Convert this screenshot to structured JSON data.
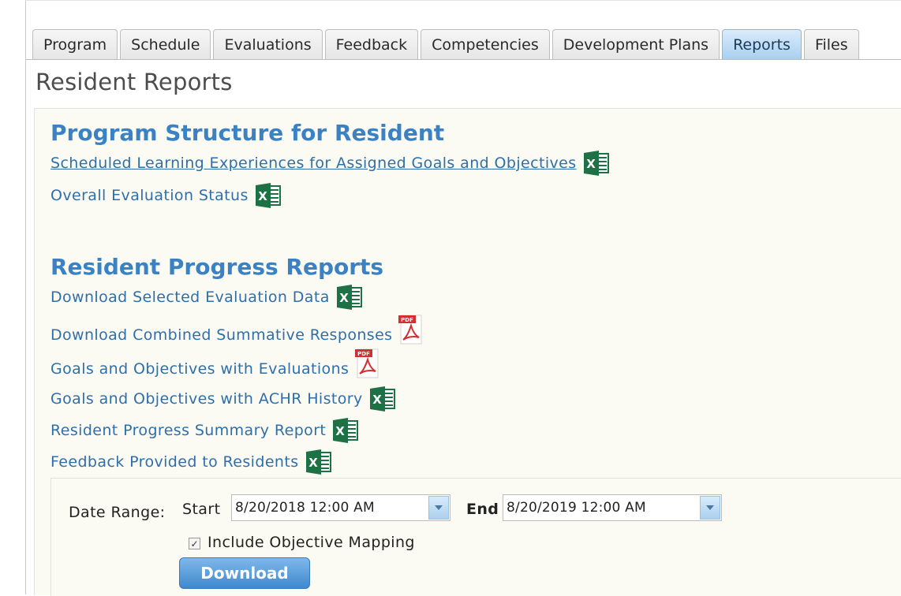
{
  "tabs": [
    "Program",
    "Schedule",
    "Evaluations",
    "Feedback",
    "Competencies",
    "Development Plans",
    "Reports",
    "Files"
  ],
  "active_tab": "Reports",
  "page_title": "Resident Reports",
  "program_structure": {
    "title": "Program Structure for Resident",
    "links": [
      {
        "label": "Scheduled Learning Experiences for Assigned Goals and Objectives ",
        "icon": "excel-icon"
      },
      {
        "label": "Overall Evaluation Status",
        "icon": "excel-icon"
      }
    ]
  },
  "progress_reports": {
    "title": "Resident Progress Reports",
    "links": [
      {
        "label": "Download Selected Evaluation Data",
        "icon": "excel-icon"
      },
      {
        "label": "Download Combined Summative Responses",
        "icon": "pdf-icon"
      },
      {
        "label": "Goals and Objectives with Evaluations",
        "icon": "pdf-icon"
      },
      {
        "label": "Goals and Objectives with ACHR History",
        "icon": "excel-icon"
      },
      {
        "label": "Resident Progress Summary Report",
        "icon": "excel-icon"
      },
      {
        "label": "Feedback Provided to Residents",
        "icon": "excel-icon"
      }
    ]
  },
  "date_range": {
    "label": "Date Range:",
    "start_label": "Start",
    "start_value": "8/20/2018 12:00 AM",
    "end_label": "End",
    "end_value": "8/20/2019 12:00 AM"
  },
  "include_mapping": {
    "label": "Include Objective Mapping",
    "checked": true
  },
  "download_button": "Download",
  "colors": {
    "link": "#2f6fa9",
    "heading": "#3a82c4",
    "excel": "#1e7145",
    "pdf": "#d32f2f"
  }
}
